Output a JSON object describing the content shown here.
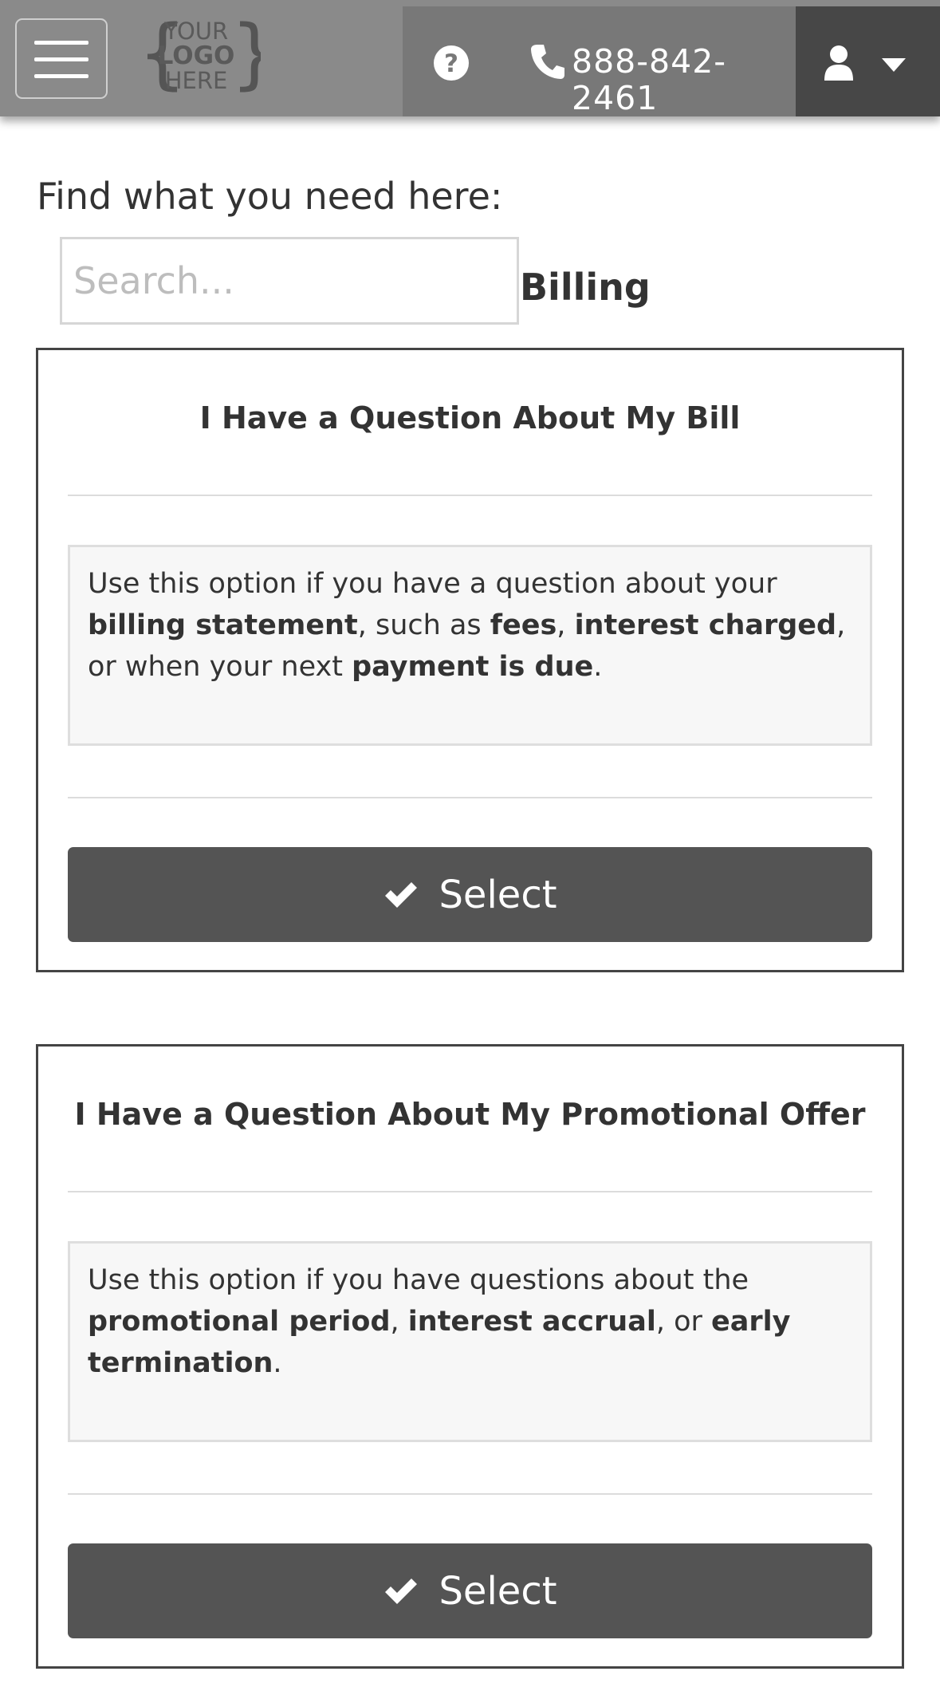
{
  "header": {
    "logo_lines": [
      "YOUR",
      "LOGO",
      "HERE"
    ],
    "phone": "888-842-2461",
    "icons": [
      "hamburger-menu-icon",
      "question-circle-icon",
      "phone-icon",
      "user-icon",
      "caret-down-icon"
    ]
  },
  "search": {
    "prompt": "Find what you need here:",
    "placeholder": "Search...",
    "value": ""
  },
  "category": "Billing",
  "options": [
    {
      "title": "I Have a Question About My Bill",
      "description": [
        {
          "text": "Use this option if you have a question about your "
        },
        {
          "text": "billing statement",
          "bold": true
        },
        {
          "text": ", such as "
        },
        {
          "text": "fees",
          "bold": true
        },
        {
          "text": ", "
        },
        {
          "text": "interest charged",
          "bold": true
        },
        {
          "text": ", or when your next "
        },
        {
          "text": "payment is due",
          "bold": true
        },
        {
          "text": "."
        }
      ],
      "button_label": "Select"
    },
    {
      "title": "I Have a Question About My Promotional Offer",
      "description": [
        {
          "text": "Use this option if you have questions about the "
        },
        {
          "text": "promotional period",
          "bold": true
        },
        {
          "text": ", "
        },
        {
          "text": "interest accrual",
          "bold": true
        },
        {
          "text": ", or "
        },
        {
          "text": "early termination",
          "bold": true
        },
        {
          "text": "."
        }
      ],
      "button_label": "Select"
    }
  ],
  "colors": {
    "header_bg": "#8a8a8a",
    "help_zone_bg": "#787878",
    "user_zone_bg": "#474747",
    "button_bg": "#545454",
    "card_border": "#444444",
    "desc_bg": "#f7f7f7"
  }
}
